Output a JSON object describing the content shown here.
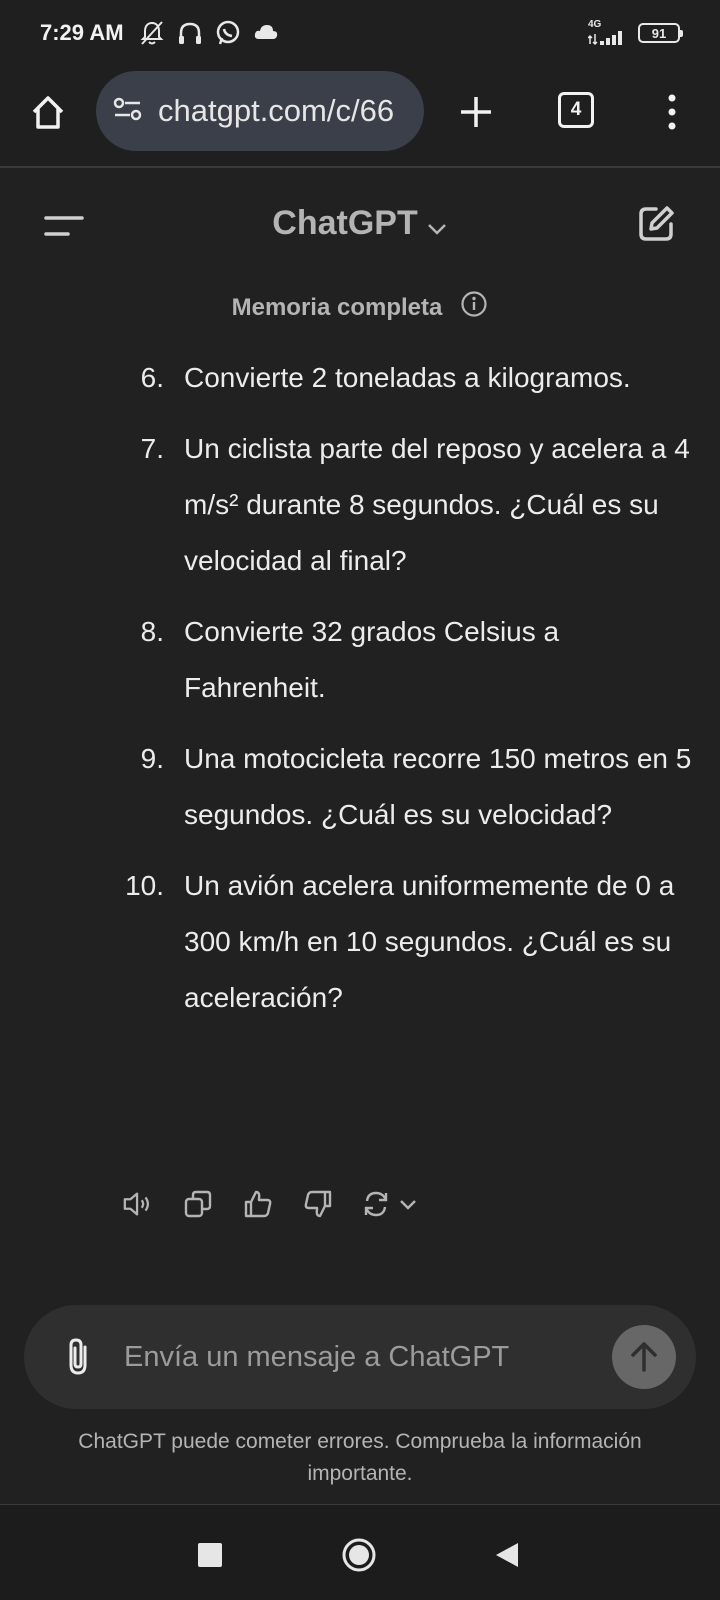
{
  "status_bar": {
    "time": "7:29 AM",
    "network_type": "4G",
    "battery_level": "91",
    "icons": [
      "notifications-off-icon",
      "headphones-icon",
      "whatsapp-icon",
      "cloud-icon",
      "signal-icon",
      "battery-icon"
    ]
  },
  "browser": {
    "url": "chatgpt.com/c/66",
    "tab_count": "4",
    "icons": [
      "home-icon",
      "site-settings-icon",
      "new-tab-icon",
      "tabs-icon",
      "more-menu-icon"
    ]
  },
  "header": {
    "model_name": "ChatGPT",
    "icons": [
      "sidebar-menu-icon",
      "chevron-down-icon",
      "new-chat-icon"
    ]
  },
  "memory_notice": {
    "label": "Memoria completa",
    "icon": "info-icon"
  },
  "messages": [
    {
      "number": "6.",
      "text": "Convierte 2 toneladas a kilogramos."
    },
    {
      "number": "7.",
      "text": "Un ciclista parte del reposo y acelera a 4 m/s² durante 8 segundos. ¿Cuál es su velocidad al final?"
    },
    {
      "number": "8.",
      "text": "Convierte 32 grados Celsius a Fahrenheit."
    },
    {
      "number": "9.",
      "text": "Una motocicleta recorre 150 metros en 5 segundos. ¿Cuál es su velocidad?"
    },
    {
      "number": "10.",
      "text": "Un avión acelera uniformemente de 0 a 300 km/h en 10 segundos. ¿Cuál es su aceleración?"
    }
  ],
  "actions": [
    "read-aloud-icon",
    "copy-icon",
    "thumbs-up-icon",
    "thumbs-down-icon",
    "regenerate-icon"
  ],
  "composer": {
    "placeholder": "Envía un mensaje a ChatGPT",
    "icons": [
      "attach-icon",
      "send-arrow-icon"
    ]
  },
  "disclaimer": "ChatGPT puede cometer errores. Comprueba la información importante.",
  "nav_bar": {
    "icons": [
      "recents-icon",
      "home-circle-icon",
      "back-icon"
    ]
  },
  "colors": {
    "background": "#212121",
    "composer_bg": "#2f2f2f",
    "url_pill_bg": "#3a3f4a",
    "send_button_bg": "#676767"
  }
}
